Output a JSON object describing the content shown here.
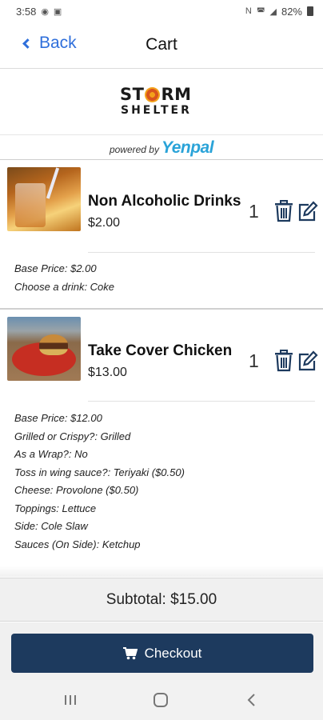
{
  "status_bar": {
    "time": "3:58",
    "battery": "82%"
  },
  "nav": {
    "back_label": "Back",
    "title": "Cart"
  },
  "brand": {
    "logo_line1_a": "ST",
    "logo_line1_b": "RM",
    "logo_line2": "SHELTER",
    "powered_by": "powered by",
    "partner": "Yenpal"
  },
  "items": [
    {
      "name": "Non Alcoholic Drinks",
      "price": "$2.00",
      "qty": "1",
      "options": [
        "Base Price: $2.00",
        "Choose a drink: Coke"
      ]
    },
    {
      "name": "Take Cover Chicken",
      "price": "$13.00",
      "qty": "1",
      "options": [
        "Base Price: $12.00",
        "Grilled or Crispy?: Grilled",
        "As a Wrap?: No",
        "Toss in wing sauce?: Teriyaki ($0.50)",
        "Cheese: Provolone ($0.50)",
        "Toppings: Lettuce",
        "Side: Cole Slaw",
        "Sauces (On Side): Ketchup"
      ]
    }
  ],
  "subtotal": "Subtotal: $15.00",
  "checkout_label": "Checkout",
  "colors": {
    "accent_blue": "#2f6fdb",
    "checkout_navy": "#1d3a5e",
    "icon_navy": "#1d3a5e"
  }
}
